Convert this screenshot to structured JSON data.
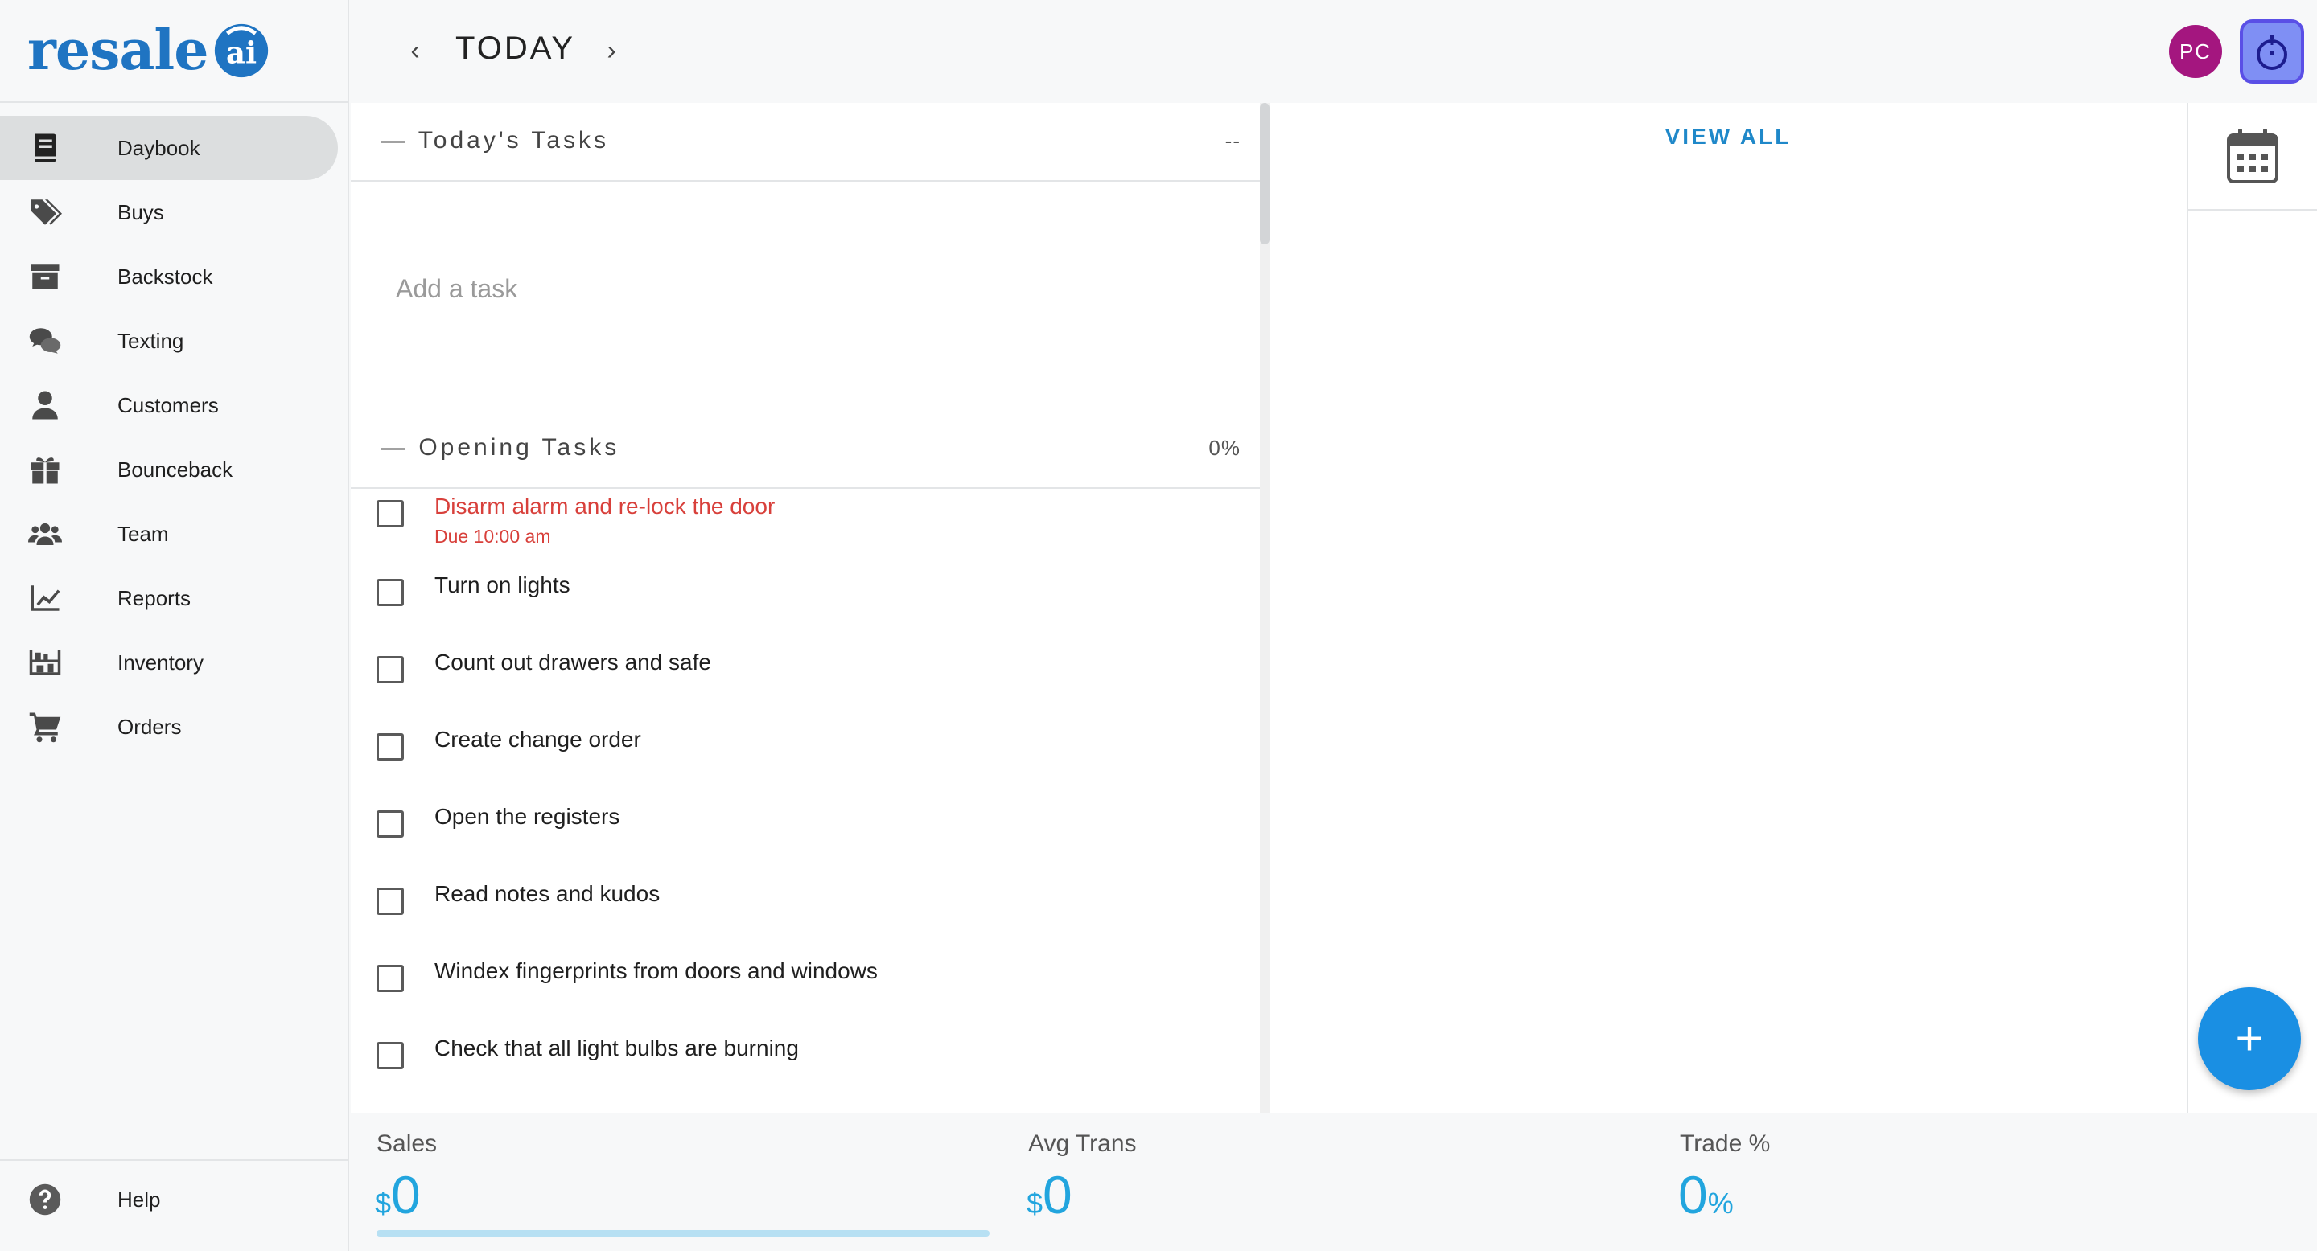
{
  "app": {
    "logo_text": "resale",
    "logo_mark_text": "ai"
  },
  "sidebar": {
    "items": [
      {
        "label": "Daybook",
        "icon": "book-icon",
        "active": true
      },
      {
        "label": "Buys",
        "icon": "tags-icon"
      },
      {
        "label": "Backstock",
        "icon": "archive-icon"
      },
      {
        "label": "Texting",
        "icon": "chat-icon"
      },
      {
        "label": "Customers",
        "icon": "person-icon"
      },
      {
        "label": "Bounceback",
        "icon": "gift-icon"
      },
      {
        "label": "Team",
        "icon": "team-icon"
      },
      {
        "label": "Reports",
        "icon": "chart-icon"
      },
      {
        "label": "Inventory",
        "icon": "shelves-icon"
      },
      {
        "label": "Orders",
        "icon": "cart-icon"
      }
    ],
    "help_label": "Help"
  },
  "header": {
    "title": "TODAY",
    "prev_symbol": "‹",
    "next_symbol": "›",
    "avatar_initials": "PC"
  },
  "todays_tasks": {
    "title": "— Today's Tasks",
    "value": "--",
    "add_placeholder": "Add a task"
  },
  "opening_tasks": {
    "title": "— Opening Tasks",
    "value": "0%",
    "tasks": [
      {
        "label": "Disarm alarm and re-lock the door",
        "due": "Due 10:00 am",
        "overdue": true
      },
      {
        "label": "Turn on lights"
      },
      {
        "label": "Count out drawers and safe"
      },
      {
        "label": "Create change order"
      },
      {
        "label": "Open the registers"
      },
      {
        "label": "Read notes and kudos"
      },
      {
        "label": "Windex fingerprints from doors and windows"
      },
      {
        "label": "Check that all light bulbs are burning"
      }
    ]
  },
  "right": {
    "view_all": "VIEW ALL",
    "fab_symbol": "+"
  },
  "stats": {
    "sales": {
      "label": "Sales",
      "currency": "$",
      "value": "0"
    },
    "avg_trans": {
      "label": "Avg Trans",
      "currency": "$",
      "value": "0"
    },
    "trade": {
      "label": "Trade %",
      "value": "0",
      "unit": "%"
    }
  },
  "colors": {
    "brand": "#1f74c2",
    "accent": "#1a8fe3",
    "stat": "#22a5de",
    "overdue": "#d8403b",
    "avatar": "#a4167f"
  }
}
